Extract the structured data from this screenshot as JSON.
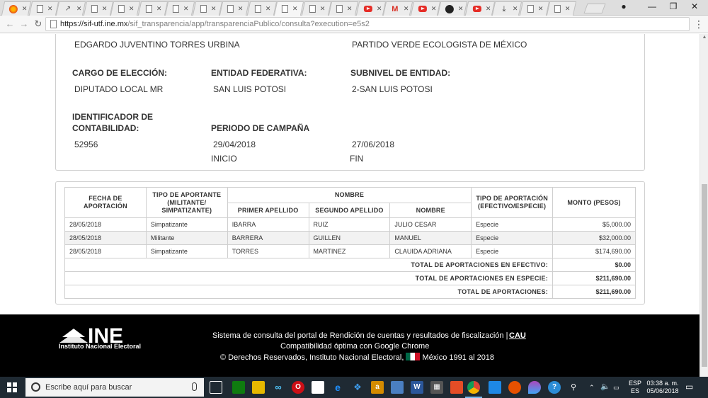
{
  "browser": {
    "url_host": "https://sif-utf.ine.mx",
    "url_path": "/sif_transparencia/app/transparenciaPublico/consulta?execution=e5s2",
    "tabs": [
      {
        "icon": "firefox-icon"
      },
      {
        "icon": "document-icon"
      },
      {
        "icon": "link-icon"
      },
      {
        "icon": "document-icon"
      },
      {
        "icon": "document-icon"
      },
      {
        "icon": "document-icon"
      },
      {
        "icon": "document-icon"
      },
      {
        "icon": "document-icon"
      },
      {
        "icon": "document-icon"
      },
      {
        "icon": "document-icon"
      },
      {
        "icon": "document-icon",
        "active": true
      },
      {
        "icon": "document-icon"
      },
      {
        "icon": "document-icon"
      },
      {
        "icon": "youtube-icon"
      },
      {
        "icon": "gmail-icon"
      },
      {
        "icon": "youtube-icon"
      },
      {
        "icon": "dark-circle-icon"
      },
      {
        "icon": "youtube-icon"
      },
      {
        "icon": "download-icon"
      },
      {
        "icon": "document-icon"
      },
      {
        "icon": "document-icon"
      }
    ]
  },
  "candidate": {
    "name": "EDGARDO JUVENTINO TORRES URBINA",
    "party": "PARTIDO VERDE ECOLOGISTA DE MÉXICO",
    "cargo_label": "CARGO DE ELECCIÓN:",
    "cargo_value": "DIPUTADO LOCAL MR",
    "entidad_label": "ENTIDAD FEDERATIVA:",
    "entidad_value": "SAN LUIS POTOSI",
    "subnivel_label": "SUBNIVEL DE ENTIDAD:",
    "subnivel_value": "2-SAN LUIS POTOSI",
    "identificador_label_1": "IDENTIFICADOR DE",
    "identificador_label_2": "CONTABILIDAD:",
    "identificador_value": "52956",
    "periodo_label": "PERIODO DE CAMPAÑA",
    "periodo_inicio": "29/04/2018",
    "periodo_fin": "27/06/2018",
    "inicio_label": "INICIO",
    "fin_label": "FIN"
  },
  "table": {
    "headers": {
      "fecha_1": "FECHA DE",
      "fecha_2": "APORTACIÓN",
      "tipo_aportante_1": "TIPO DE APORTANTE",
      "tipo_aportante_2": "(MILITANTE/",
      "tipo_aportante_3": "SIMPATIZANTE)",
      "nombre_group": "NOMBRE",
      "primer_apellido": "PRIMER APELLIDO",
      "segundo_apellido": "SEGUNDO APELLIDO",
      "nombre": "NOMBRE",
      "tipo_aportacion_1": "TIPO DE APORTACIÓN",
      "tipo_aportacion_2": "(EFECTIVO/ESPECIE)",
      "monto": "MONTO (PESOS)"
    },
    "rows": [
      {
        "fecha": "28/05/2018",
        "tipo": "Simpatizante",
        "primer": "IBARRA",
        "segundo": "RUIZ",
        "nombre": "JULIO CESAR",
        "aportacion": "Especie",
        "monto": "$5,000.00"
      },
      {
        "fecha": "28/05/2018",
        "tipo": "Militante",
        "primer": "BARRERA",
        "segundo": "GUILLEN",
        "nombre": "MANUEL",
        "aportacion": "Especie",
        "monto": "$32,000.00"
      },
      {
        "fecha": "28/05/2018",
        "tipo": "Simpatizante",
        "primer": "TORRES",
        "segundo": "MARTINEZ",
        "nombre": "CLAUIDA ADRIANA",
        "aportacion": "Especie",
        "monto": "$174,690.00"
      }
    ],
    "totals": [
      {
        "label": "TOTAL DE APORTACIONES EN EFECTIVO:",
        "value": "$0.00"
      },
      {
        "label": "TOTAL DE APORTACIONES EN ESPECIE:",
        "value": "$211,690.00"
      },
      {
        "label": "TOTAL DE APORTACIONES:",
        "value": "$211,690.00"
      }
    ]
  },
  "footer": {
    "logo_text": "INE",
    "logo_sub": "Instituto Nacional Electoral",
    "line1": "Sistema de consulta del portal de Rendición de cuentas y resultados de fiscalización |",
    "line2": "Compatibilidad óptima con Google Chrome",
    "line3_a": "© Derechos Reservados, Instituto Nacional Electoral,",
    "line3_b": "México 1991 al 2018",
    "cau": "CAU"
  },
  "taskbar": {
    "search_placeholder": "Escribe aquí para buscar",
    "lang_1": "ESP",
    "lang_2": "ES",
    "time": "03:38 a. m.",
    "date": "05/06/2018"
  },
  "colors": {
    "footer_bg": "#000000",
    "taskbar_bg": "#1f2a33",
    "youtube_red": "#e52d27"
  }
}
